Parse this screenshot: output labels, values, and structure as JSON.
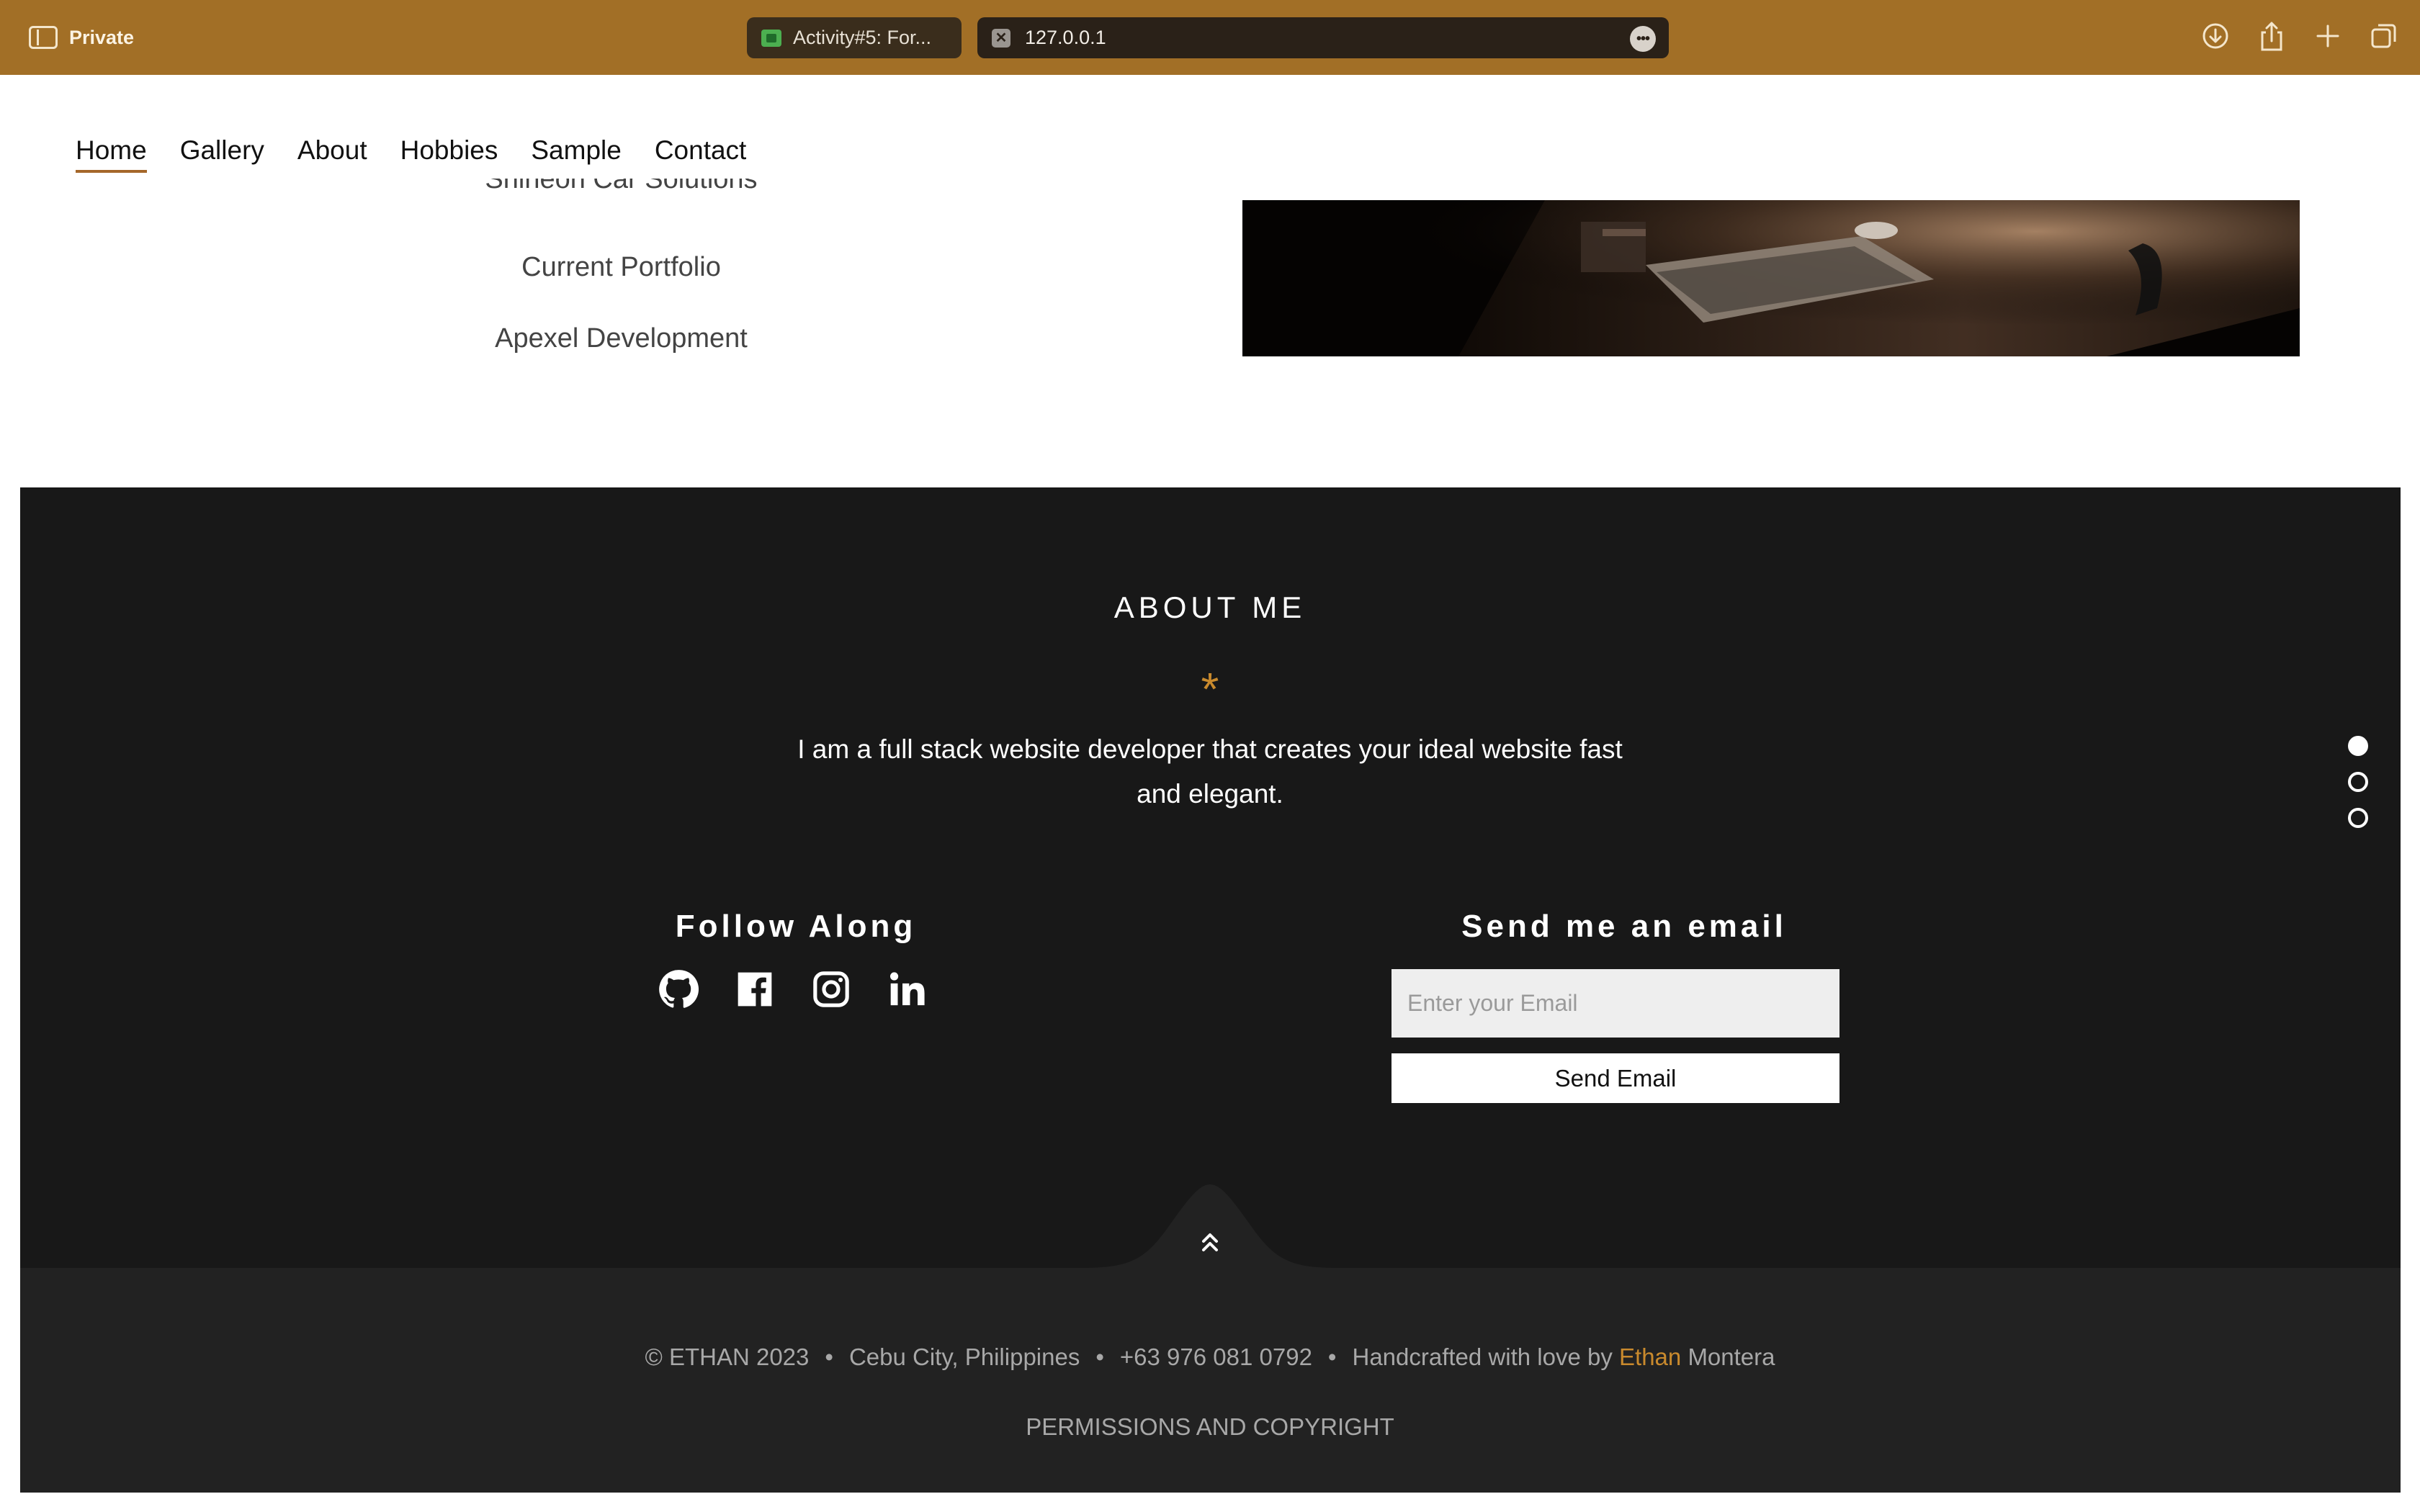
{
  "browser": {
    "mode_label": "Private",
    "tabs": [
      {
        "title": "Activity#5: For..."
      },
      {
        "title": "127.0.0.1"
      }
    ],
    "toolbar_icons": [
      "download-icon",
      "share-icon",
      "new-tab-icon",
      "tab-overview-icon"
    ]
  },
  "nav": {
    "items": [
      {
        "label": "Home",
        "active": true
      },
      {
        "label": "Gallery"
      },
      {
        "label": "About"
      },
      {
        "label": "Hobbies"
      },
      {
        "label": "Sample"
      },
      {
        "label": "Contact"
      }
    ]
  },
  "projects": {
    "items": [
      {
        "label": "Shineon Car Solutions"
      },
      {
        "label": "Current Portfolio"
      },
      {
        "label": "Apexel Development"
      }
    ]
  },
  "about": {
    "title": "ABOUT ME",
    "ornament": "*",
    "text": "I am a full stack website developer that creates your ideal website fast and elegant."
  },
  "follow": {
    "title": "Follow Along",
    "icons": [
      "github-icon",
      "facebook-icon",
      "instagram-icon",
      "linkedin-icon"
    ]
  },
  "email": {
    "title": "Send me an email",
    "placeholder": "Enter your Email",
    "button_label": "Send Email"
  },
  "slider": {
    "count": 3,
    "active_index": 0
  },
  "footer": {
    "copyright": "© ETHAN 2023",
    "location": "Cebu City, Philippines",
    "phone": "+63 976 081 0792",
    "credit_prefix": "Handcrafted with love by",
    "credit_first": "Ethan",
    "credit_last": "Montera",
    "separator": "•",
    "permissions": "PERMISSIONS AND COPYRIGHT"
  },
  "colors": {
    "chrome": "#a26f26",
    "accent": "#c98a2d",
    "footer_dark": "#181818",
    "footer_bottom": "#222222"
  }
}
